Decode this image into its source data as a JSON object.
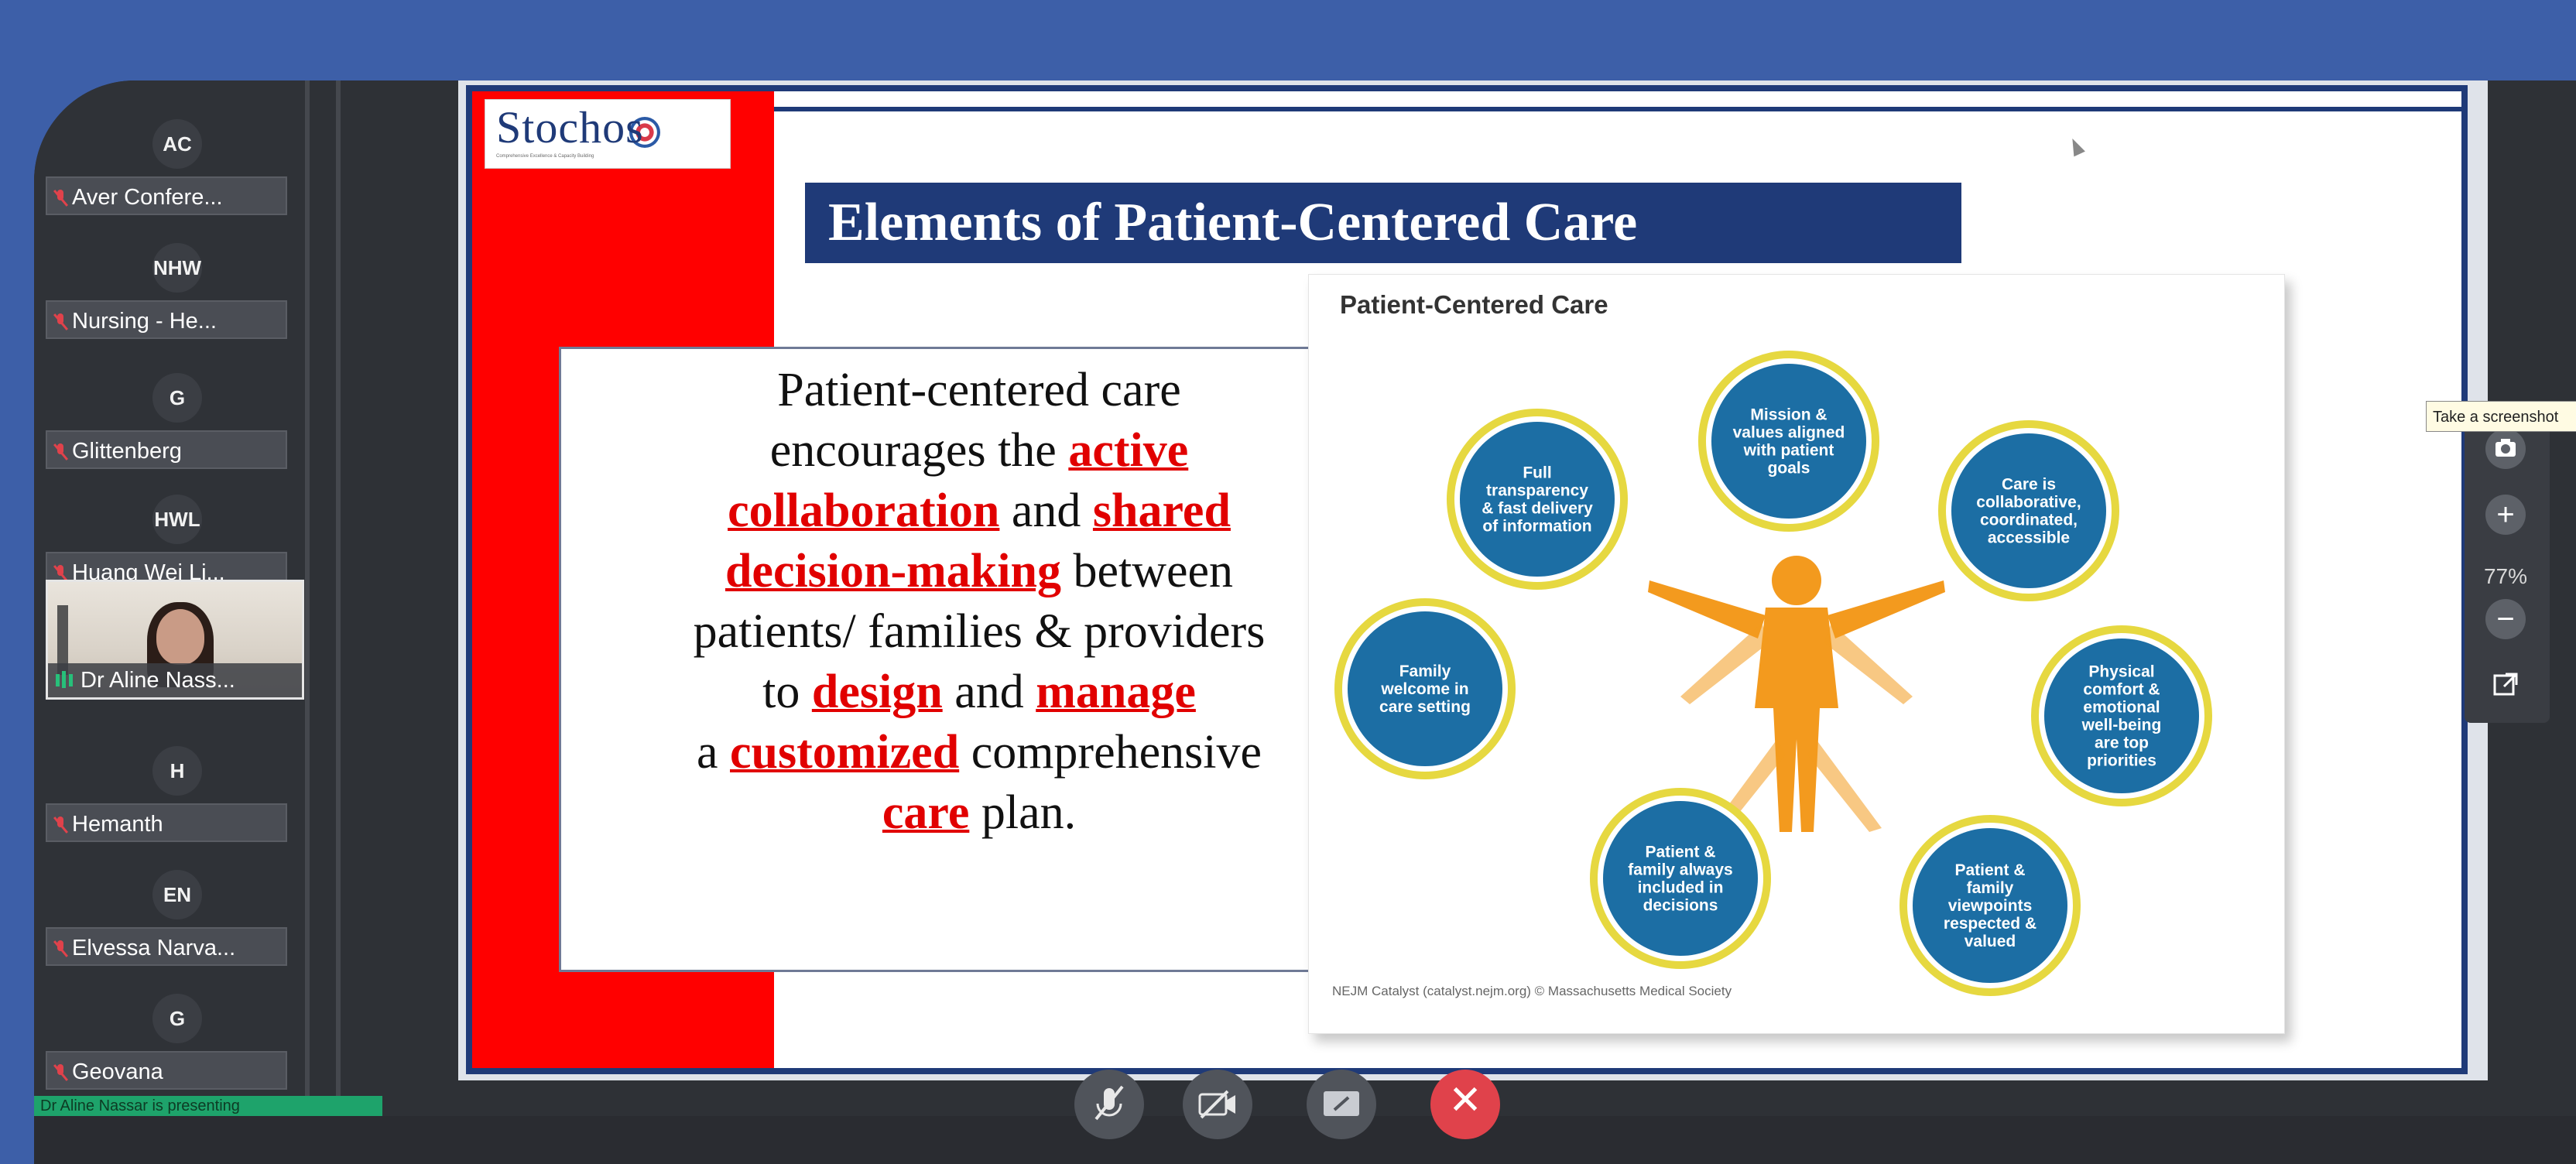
{
  "participants": [
    {
      "initials": "AC",
      "name": "Aver Confere..."
    },
    {
      "initials": "NHW",
      "name": "Nursing - He..."
    },
    {
      "initials": "G",
      "name": "Glittenberg"
    },
    {
      "initials": "HWL",
      "name": "Huang Wei Li..."
    },
    {
      "initials": "H",
      "name": "Hemanth"
    },
    {
      "initials": "EN",
      "name": "Elvessa Narva..."
    },
    {
      "initials": "G",
      "name": "Geovana"
    }
  ],
  "video_tile": {
    "name": "Dr Aline Nass..."
  },
  "slide": {
    "logo": "Stochos",
    "logo_tagline": "Comprehensive Excellence & Capacity Building",
    "title": "Elements of Patient-Centered Care",
    "body": {
      "l1": "Patient-centered care",
      "l2a": "encourages the ",
      "active": "active",
      "collaboration": "collaboration",
      "l3b": " and ",
      "shared": "shared",
      "decision": "decision-making",
      "l4b": " between",
      "l5": "patients/ families & providers",
      "l6a": "to ",
      "design": "design",
      "l6b": " and ",
      "manage": "manage",
      "l7a": "a ",
      "customized": "customized",
      "l7b": " comprehensive",
      "care": "care",
      "l8b": " plan."
    },
    "figure": {
      "title": "Patient-Centered Care",
      "credit": "NEJM Catalyst (catalyst.nejm.org) © Massachusetts Medical Society",
      "circles": [
        [
          "Mission &",
          "values aligned",
          "with patient",
          "goals"
        ],
        [
          "Care is",
          "collaborative,",
          "coordinated,",
          "accessible"
        ],
        [
          "Physical",
          "comfort &",
          "emotional",
          "well-being",
          "are top",
          "priorities"
        ],
        [
          "Patient &",
          "family",
          "viewpoints",
          "respected &",
          "valued"
        ],
        [
          "Patient &",
          "family always",
          "included in",
          "decisions"
        ],
        [
          "Family",
          "welcome in",
          "care setting"
        ],
        [
          "Full",
          "transparency",
          "& fast delivery",
          "of information"
        ]
      ],
      "colors": {
        "circle": "#1c6ea4",
        "ring": "#e6d840",
        "figure": "#f39a1e"
      }
    }
  },
  "zoom": {
    "level": "77%",
    "tooltip": "Take a screenshot"
  },
  "footer": {
    "presenting": "Dr Aline Nassar is presenting"
  },
  "controls": {
    "mic": "mic-off-icon",
    "video": "video-off-icon",
    "share": "share-screen-icon",
    "end": "✕"
  },
  "colors": {
    "background": "#3d5fa8",
    "accent_red": "#ff0000",
    "navy": "#1f3a78"
  }
}
